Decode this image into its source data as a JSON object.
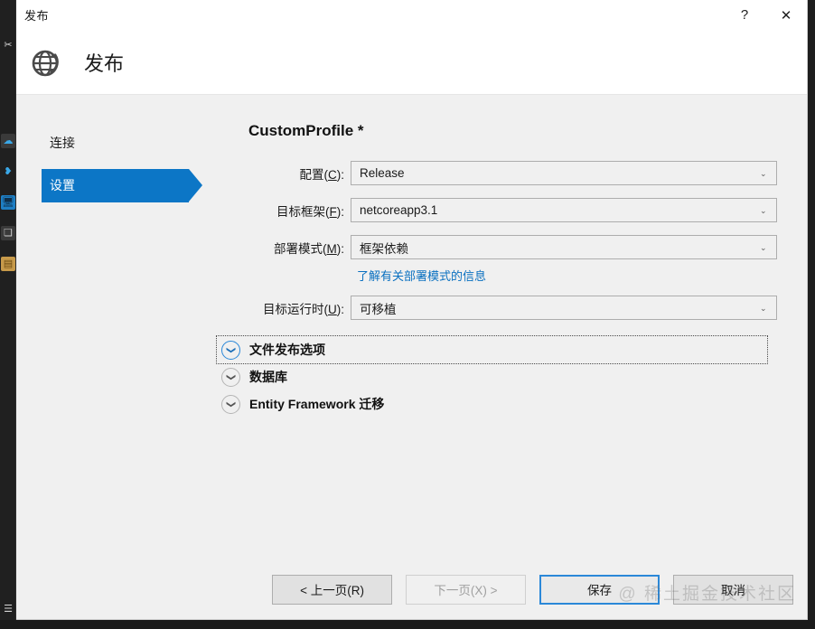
{
  "window": {
    "titlebar_text": "发布",
    "help_label": "?",
    "close_label": "✕",
    "header_title": "发布",
    "header_icon": "globe-publish-icon"
  },
  "sidebar": {
    "items": [
      {
        "label": "连接",
        "selected": false
      },
      {
        "label": "设置",
        "selected": true
      }
    ]
  },
  "main": {
    "profile_title": "CustomProfile *",
    "fields": [
      {
        "label_prefix": "配置(",
        "accelerator": "C",
        "label_suffix": "):",
        "value": "Release",
        "icon": "chevron-down-icon"
      },
      {
        "label_prefix": "目标框架(",
        "accelerator": "F",
        "label_suffix": "):",
        "value": "netcoreapp3.1",
        "icon": "chevron-down-icon"
      },
      {
        "label_prefix": "部署模式(",
        "accelerator": "M",
        "label_suffix": "):",
        "value": "框架依赖",
        "icon": "chevron-down-icon"
      },
      {
        "label_prefix": "目标运行时(",
        "accelerator": "U",
        "label_suffix": "):",
        "value": "可移植",
        "icon": "chevron-down-icon"
      }
    ],
    "deployment_hint_link": "了解有关部署模式的信息",
    "expanders": [
      {
        "label": "文件发布选项",
        "focused": true,
        "icon": "chevron-down-icon"
      },
      {
        "label": "数据库",
        "focused": false,
        "icon": "chevron-down-icon"
      },
      {
        "label": "Entity Framework 迁移",
        "focused": false,
        "icon": "chevron-down-icon"
      }
    ]
  },
  "footer": {
    "prev_label": "< 上一页(R)",
    "next_label": "下一页(X) >",
    "save_label": "保存",
    "cancel_label": "取消"
  },
  "watermark": "@ 稀土掘金技术社区",
  "colors": {
    "accent": "#0c76c6",
    "link": "#0a70c0",
    "focus_border": "#2b88d8",
    "window_bg": "#f0f0f0",
    "header_bg": "#ffffff"
  }
}
